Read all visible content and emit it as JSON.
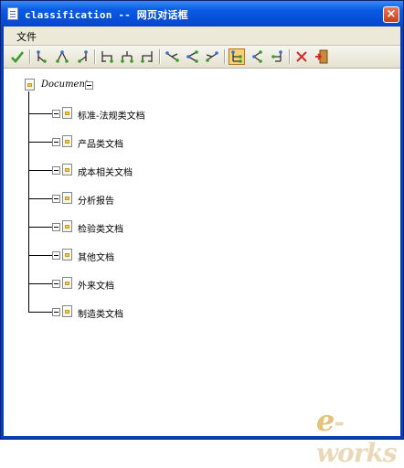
{
  "window": {
    "title": "classification -- 网页对话框",
    "close_glyph": "×"
  },
  "menu": {
    "items": [
      "文件"
    ]
  },
  "toolbar": {
    "buttons": [
      {
        "name": "check-icon",
        "color": "#3a9c28"
      },
      {
        "name": "tree-layout-1-icon"
      },
      {
        "name": "tree-layout-2-icon"
      },
      {
        "name": "tree-layout-3-icon"
      },
      {
        "name": "tree-layout-4-icon"
      },
      {
        "name": "tree-layout-5-icon"
      },
      {
        "name": "tree-layout-6-icon"
      },
      {
        "name": "tree-layout-7-icon"
      },
      {
        "name": "tree-layout-8-icon"
      },
      {
        "name": "tree-layout-9-icon"
      },
      {
        "name": "tree-layout-10-icon",
        "active": true
      },
      {
        "name": "tree-layout-11-icon"
      },
      {
        "name": "tree-layout-12-icon"
      },
      {
        "name": "delete-icon",
        "color": "#d42a2a"
      },
      {
        "name": "exit-icon"
      }
    ]
  },
  "tree": {
    "root": {
      "label": "Document",
      "expanded": true
    },
    "children": [
      {
        "label": "标准-法规类文档"
      },
      {
        "label": "产品类文档"
      },
      {
        "label": "成本相关文档"
      },
      {
        "label": "分析报告"
      },
      {
        "label": "检验类文档"
      },
      {
        "label": "其他文档"
      },
      {
        "label": "外来文档"
      },
      {
        "label": "制造类文档"
      }
    ]
  },
  "watermark": {
    "text_prefix": "e",
    "text_suffix": "-works"
  }
}
